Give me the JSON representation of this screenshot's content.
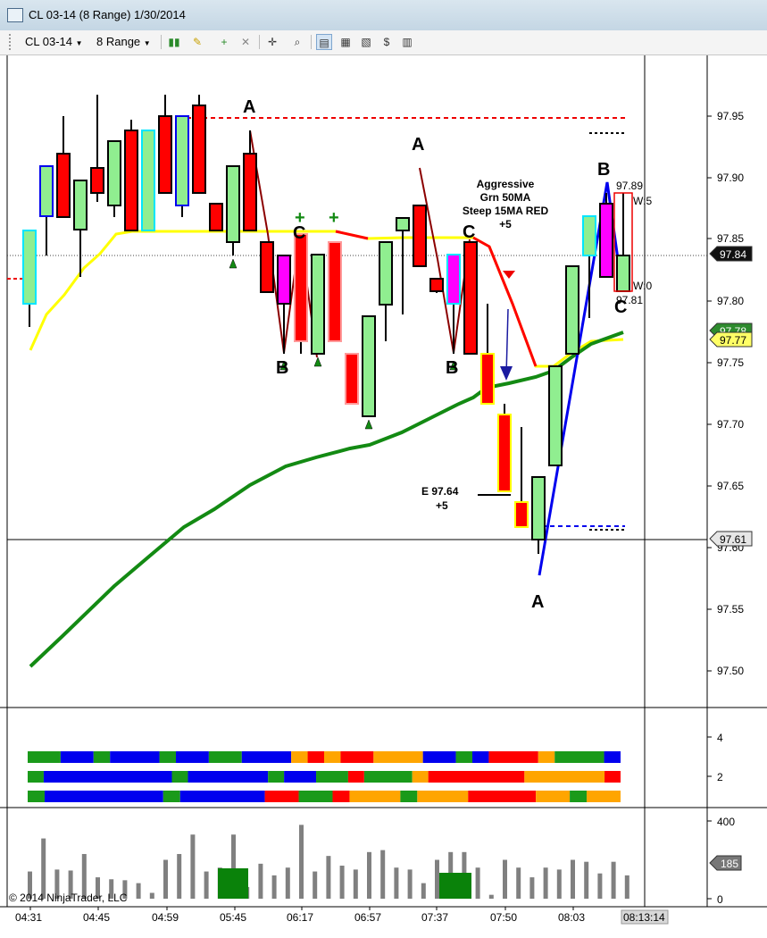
{
  "window": {
    "title": "CL 03-14 (8 Range)  1/30/2014"
  },
  "toolbar": {
    "instrument": "CL 03-14",
    "period": "8 Range",
    "buttons": [
      "chart-style-icon",
      "draw-pencil-icon",
      "add-indicator-icon",
      "remove-icon",
      "crosshair-icon",
      "zoom-icon",
      "data-box-icon",
      "strategies-icon",
      "properties-icon",
      "snapshot-icon",
      "layout-icon"
    ]
  },
  "chart": {
    "price_axis_labels": [
      "97.95",
      "97.90",
      "97.85",
      "97.80",
      "97.75",
      "97.70",
      "97.65",
      "97.60",
      "97.55",
      "97.50"
    ],
    "price_markers": [
      {
        "label": "97.84",
        "bg": "#111111",
        "fg": "#ffffff"
      },
      {
        "label": "97.78",
        "bg": "#2e8b2e",
        "fg": "#ffffff"
      },
      {
        "label": "97.77",
        "bg": "#ffff66",
        "fg": "#000000"
      },
      {
        "label": "97.61",
        "bg": "#e6e6e6",
        "fg": "#000000"
      }
    ],
    "time_labels": [
      "04:31",
      "04:45",
      "04:59",
      "05:45",
      "06:17",
      "06:57",
      "07:37",
      "07:50",
      "08:03"
    ],
    "current_time": "08:13:14",
    "copyright": "© 2014 NinjaTrader, LLC",
    "annotations": {
      "abc": [
        "A",
        "C",
        "B",
        "A",
        "C",
        "B",
        "A",
        "B",
        "C"
      ],
      "trade_note": "Aggressive\nGrn 50MA\nSteep 15MA RED\n+5",
      "entry_note": "E 97.64",
      "entry_result": "+5",
      "range_top": "97.89",
      "range_bottom": "97.81",
      "w_top": "W:5",
      "w_bottom": "W:0"
    },
    "colors": {
      "up": "#90ee90",
      "down": "#ff0000",
      "ma_slow": "#138a13",
      "ma_fast_up": "#ffff00",
      "ma_fast_down": "#ff0000",
      "wave_down": "#8b0000",
      "wave_up": "#0000ff"
    }
  },
  "panel2": {
    "axis_labels": [
      "4",
      "2"
    ]
  },
  "panel3": {
    "axis_labels": [
      "400",
      "0"
    ],
    "volume_marker": "185"
  }
}
